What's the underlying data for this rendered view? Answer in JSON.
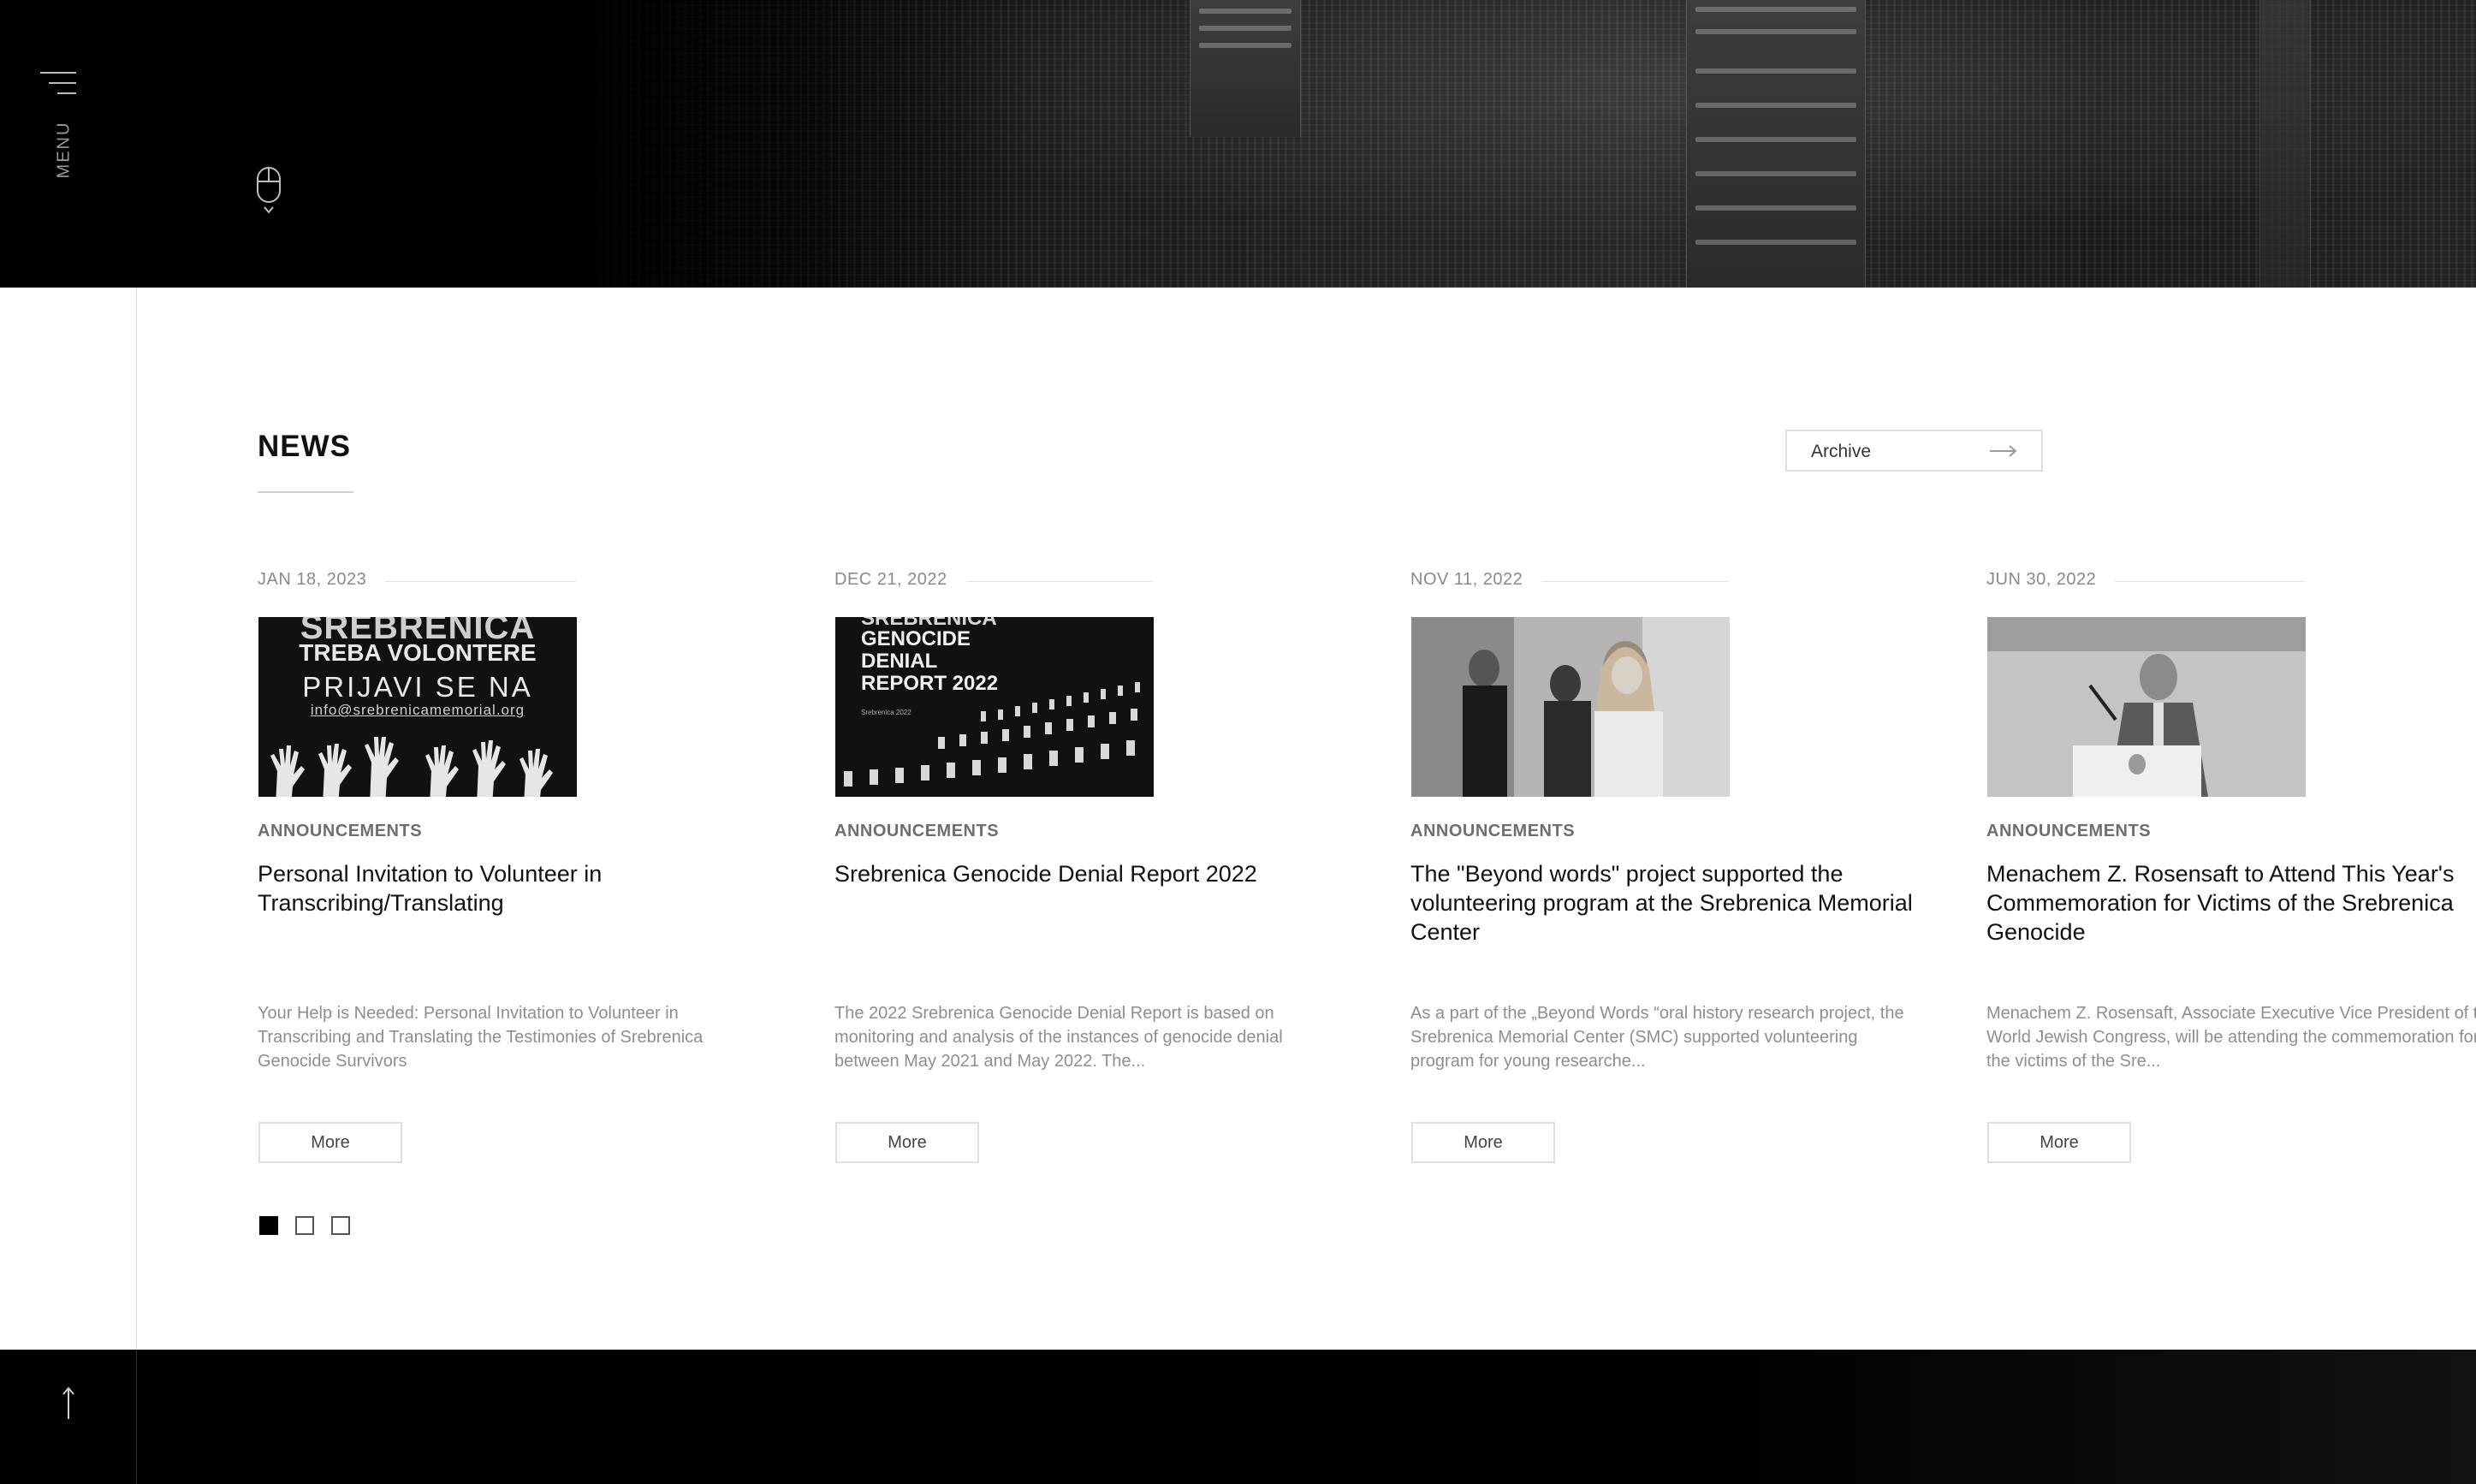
{
  "sidebar": {
    "menu_label": "MENU"
  },
  "news": {
    "title": "NEWS",
    "archive_label": "Archive",
    "more_label": "More",
    "items": [
      {
        "date": "JAN 18, 2023",
        "category": "ANNOUNCEMENTS",
        "headline": "Personal Invitation to Volunteer in Transcribing/Translating",
        "excerpt": "Your Help is Needed: Personal Invitation to Volunteer in Transcribing and Translating the Testimonies of Srebrenica Genocide Survivors",
        "thumb_text": [
          "SREBRENICA",
          "TREBA VOLONTERE",
          "PRIJAVI SE NA",
          "info@srebrenicamemorial.org"
        ]
      },
      {
        "date": "DEC 21, 2022",
        "category": "ANNOUNCEMENTS",
        "headline": "Srebrenica Genocide Denial Report 2022",
        "excerpt": "The 2022 Srebrenica Genocide Denial Report is based on monitoring and analysis of the instances of genocide denial between May 2021 and May 2022. The...",
        "thumb_text": [
          "SREBRENICA",
          "GENOCIDE",
          "DENIAL",
          "REPORT 2022",
          "Srebrenica 2022"
        ]
      },
      {
        "date": "NOV 11, 2022",
        "category": "ANNOUNCEMENTS",
        "headline": "The \"Beyond words\" project supported the volunteering program at the Srebrenica Memorial Center",
        "excerpt": "As a part of the „Beyond Words “oral history research project, the Srebrenica Memorial Center (SMC) supported volunteering program for young researche..."
      },
      {
        "date": "JUN 30, 2022",
        "category": "ANNOUNCEMENTS",
        "headline": "Menachem Z. Rosensaft to Attend This Year's Commemoration for Victims of the Srebrenica Genocide",
        "excerpt": "Menachem Z. Rosensaft, Associate Executive Vice President of the World Jewish Congress, will be attending the commemoration for the victims of the Sre..."
      }
    ],
    "pager": {
      "total": 3,
      "active": 1
    }
  },
  "colors": {
    "text_primary": "#111111",
    "text_muted": "#8e8e8e",
    "border": "#dedede",
    "dark_band": "#000000"
  }
}
